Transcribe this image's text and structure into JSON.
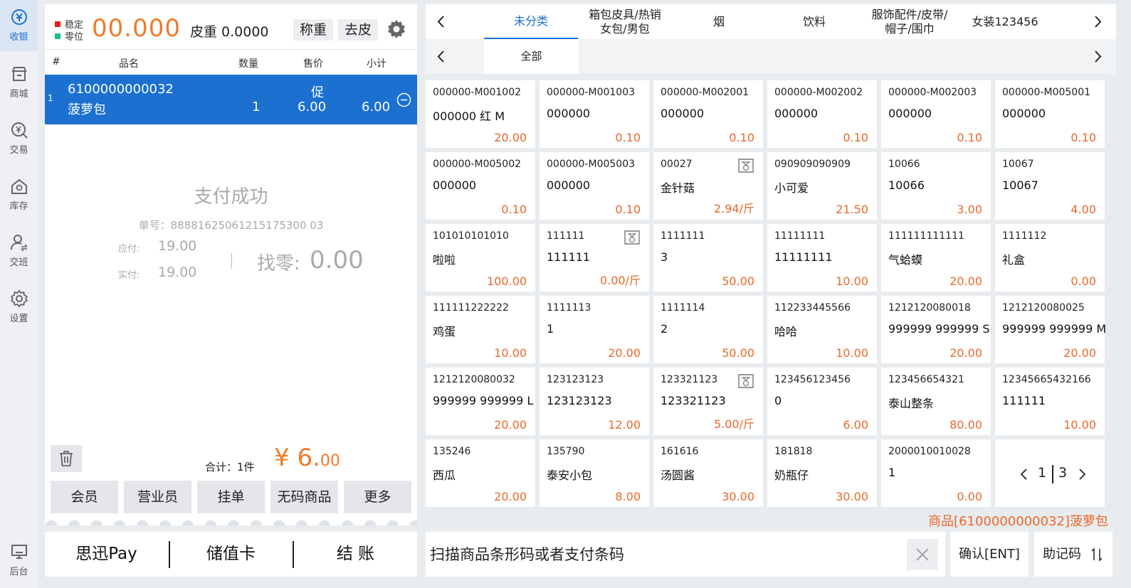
{
  "nav": {
    "items": [
      {
        "label": "收银",
        "icon": "cashier-icon"
      },
      {
        "label": "商城",
        "icon": "store-icon"
      },
      {
        "label": "交易",
        "icon": "transaction-icon"
      },
      {
        "label": "库存",
        "icon": "inventory-icon"
      },
      {
        "label": "交班",
        "icon": "shift-handover-icon"
      },
      {
        "label": "设置",
        "icon": "settings-icon"
      }
    ],
    "backend": {
      "label": "后台",
      "icon": "backend-icon"
    },
    "active_color": "#1b6fd0"
  },
  "scale": {
    "stable_label": "稳定",
    "zero_label": "零位",
    "stable_color": "#e02020",
    "zero_color": "#1bbf8a",
    "weight": "00.000",
    "tare_text": "皮重 0.0000",
    "weigh_button": "称重",
    "tare_button": "去皮"
  },
  "cart": {
    "headers": {
      "index": "#",
      "name": "品名",
      "qty": "数量",
      "price": "售价",
      "subtotal": "小计"
    },
    "items": [
      {
        "index": "1",
        "code": "6100000000032",
        "name": "菠萝包",
        "qty": "1",
        "promo": "促",
        "price": "6.00",
        "subtotal": "6.00"
      }
    ]
  },
  "payment_result": {
    "title": "支付成功",
    "order_no": "单号：88881625061215175300 03",
    "due_label": "应付:",
    "due_value": "19.00",
    "paid_label": "实付:",
    "paid_value": "19.00",
    "change_label": "找零:",
    "change_value": "0.00"
  },
  "totals": {
    "count_text": "合计：1件",
    "amount_main": "¥ 6.",
    "amount_decimal": "00"
  },
  "actions": {
    "member": "会员",
    "sales_clerk": "营业员",
    "hold": "挂单",
    "no_code_item": "无码商品",
    "more": "更多"
  },
  "pay_bar": {
    "sixun_pay": "思迅Pay",
    "stored_value": "储值卡",
    "checkout": "结 账"
  },
  "categories": {
    "tabs": [
      "未分类",
      "箱包皮具/热销\n女包/男包",
      "烟",
      "饮料",
      "服饰配件/皮带/\n帽子/围巾",
      "女装123456"
    ],
    "active_index": 0,
    "sub_tabs": [
      "全部"
    ],
    "active_sub_index": 0
  },
  "products": [
    {
      "code": "000000-M001002",
      "name": "000000 红 M",
      "price": "20.00",
      "weighed": false
    },
    {
      "code": "000000-M001003",
      "name": "000000",
      "price": "0.10",
      "weighed": false
    },
    {
      "code": "000000-M002001",
      "name": "000000",
      "price": "0.10",
      "weighed": false
    },
    {
      "code": "000000-M002002",
      "name": "000000",
      "price": "0.10",
      "weighed": false
    },
    {
      "code": "000000-M002003",
      "name": "000000",
      "price": "0.10",
      "weighed": false
    },
    {
      "code": "000000-M005001",
      "name": "000000",
      "price": "0.10",
      "weighed": false
    },
    {
      "code": "000000-M005002",
      "name": "000000",
      "price": "0.10",
      "weighed": false
    },
    {
      "code": "000000-M005003",
      "name": "000000",
      "price": "0.10",
      "weighed": false
    },
    {
      "code": "00027",
      "name": "金针菇",
      "price": "2.94/斤",
      "weighed": true
    },
    {
      "code": "090909090909",
      "name": "小可爱",
      "price": "21.50",
      "weighed": false
    },
    {
      "code": "10066",
      "name": "10066",
      "price": "3.00",
      "weighed": false
    },
    {
      "code": "10067",
      "name": "10067",
      "price": "4.00",
      "weighed": false
    },
    {
      "code": "101010101010",
      "name": "啦啦",
      "price": "100.00",
      "weighed": false
    },
    {
      "code": "111111",
      "name": "111111",
      "price": "0.00/斤",
      "weighed": true
    },
    {
      "code": "1111111",
      "name": "3",
      "price": "50.00",
      "weighed": false
    },
    {
      "code": "11111111",
      "name": "11111111",
      "price": "10.00",
      "weighed": false
    },
    {
      "code": "111111111111",
      "name": "气蛤蟆",
      "price": "20.00",
      "weighed": false
    },
    {
      "code": "1111112",
      "name": "礼盒",
      "price": "0.00",
      "weighed": false
    },
    {
      "code": "111111222222",
      "name": "鸡蛋",
      "price": "10.00",
      "weighed": false
    },
    {
      "code": "1111113",
      "name": "1",
      "price": "20.00",
      "weighed": false
    },
    {
      "code": "1111114",
      "name": "2",
      "price": "50.00",
      "weighed": false
    },
    {
      "code": "112233445566",
      "name": "哈哈",
      "price": "10.00",
      "weighed": false
    },
    {
      "code": "1212120080018",
      "name": "999999 999999 S",
      "price": "20.00",
      "weighed": false
    },
    {
      "code": "1212120080025",
      "name": "999999 999999 M",
      "price": "20.00",
      "weighed": false
    },
    {
      "code": "1212120080032",
      "name": "999999 999999 L",
      "price": "20.00",
      "weighed": false
    },
    {
      "code": "123123123",
      "name": "123123123",
      "price": "12.00",
      "weighed": false
    },
    {
      "code": "123321123",
      "name": "123321123",
      "price": "5.00/斤",
      "weighed": true
    },
    {
      "code": "123456123456",
      "name": "0",
      "price": "6.00",
      "weighed": false
    },
    {
      "code": "123456654321",
      "name": "泰山整条",
      "price": "80.00",
      "weighed": false
    },
    {
      "code": "12345665432166",
      "name": "111111",
      "price": "10.00",
      "weighed": false
    },
    {
      "code": "135246",
      "name": "西瓜",
      "price": "20.00",
      "weighed": false
    },
    {
      "code": "135790",
      "name": "泰安小包",
      "price": "8.00",
      "weighed": false
    },
    {
      "code": "161616",
      "name": "汤圆酱",
      "price": "30.00",
      "weighed": false
    },
    {
      "code": "181818",
      "name": "奶瓶仔",
      "price": "30.00",
      "weighed": false
    },
    {
      "code": "2000010010028",
      "name": "1",
      "price": "0.00",
      "weighed": false
    }
  ],
  "pagination": {
    "current": "1",
    "total": "3"
  },
  "status_line": "商品[6100000000032]菠萝包",
  "scan": {
    "placeholder": "扫描商品条形码或者支付条码",
    "confirm": "确认[ENT]",
    "mnemonic": "助记码"
  },
  "colors": {
    "accent": "#1b70d0",
    "price": "#e8692a",
    "weight": "#f07a2a"
  }
}
